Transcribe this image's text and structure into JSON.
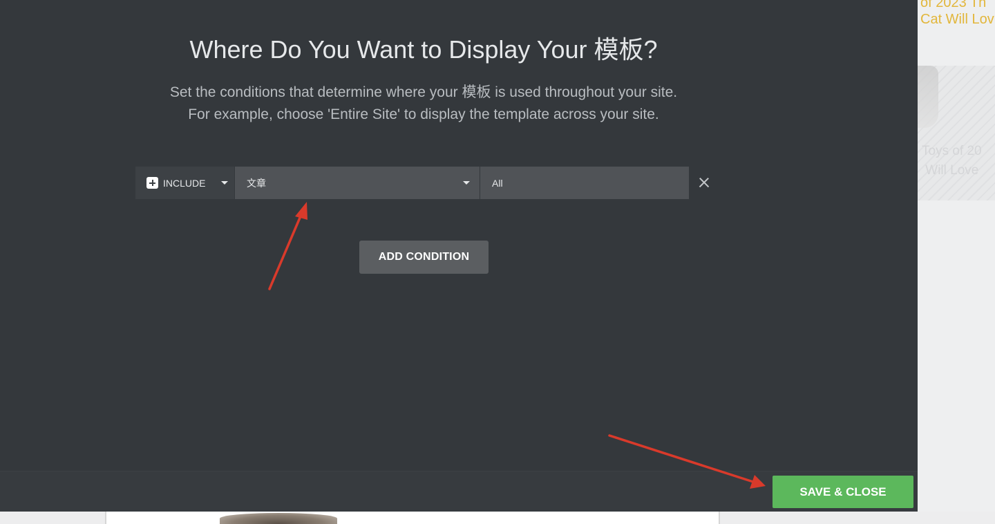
{
  "background_page": {
    "headline": "of 2023 Th\nCat Will Lov",
    "card_title": "Toys of 20\n Will Love"
  },
  "modal": {
    "title": "Where Do You Want to Display Your 模板?",
    "description_line1": "Set the conditions that determine where your 模板 is used throughout your site.",
    "description_line2": "For example, choose 'Entire Site' to display the template across your site.",
    "condition": {
      "type_label": "INCLUDE",
      "name_value": "文章",
      "sub_value": "All"
    },
    "add_condition_label": "ADD CONDITION",
    "save_close_label": "SAVE & CLOSE"
  },
  "colors": {
    "modal_bg": "#34383c",
    "save_button": "#5cb85c",
    "annotation_arrow": "#d93a2b"
  },
  "icons": {
    "include": "plus-square-icon",
    "dropdown": "caret-down-icon",
    "remove": "close-icon"
  }
}
